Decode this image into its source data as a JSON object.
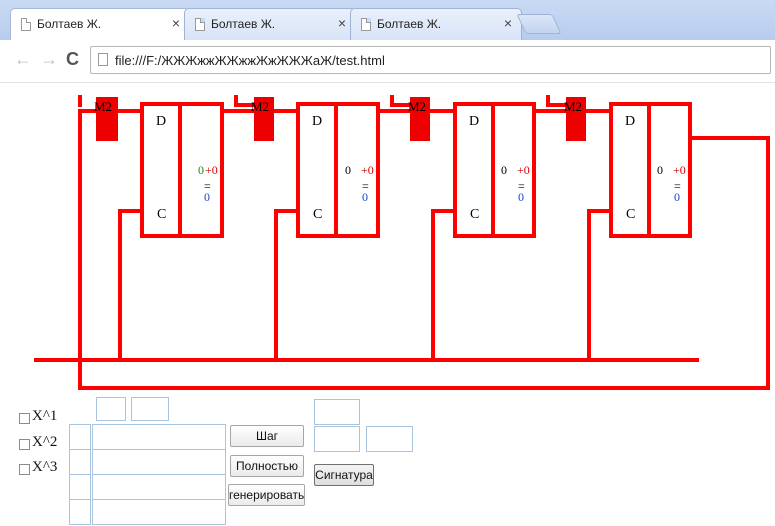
{
  "browser": {
    "tabs": [
      {
        "title": "Болтаев Ж.",
        "close": "×",
        "active": true
      },
      {
        "title": "Болтаев Ж.",
        "close": "×",
        "active": false
      },
      {
        "title": "Болтаев Ж.",
        "close": "×",
        "active": false
      }
    ],
    "nav": {
      "back": "←",
      "forward": "→",
      "reload": "C"
    },
    "url": "file:///F:/ЖЖЖжжЖЖжжЖжЖЖЖаЖ/test.html"
  },
  "circuit": {
    "colors": {
      "wire": "#ff0000",
      "mod": "#ee0000",
      "green": "#1a8a1a",
      "blue": "#1a3fd1"
    },
    "modules": [
      "M2",
      "M2",
      "M2",
      "M2"
    ],
    "triggers": [
      {
        "d": "D",
        "c": "C",
        "q": "0",
        "plus": "+0",
        "bar": "=",
        "blue": "0"
      },
      {
        "d": "D",
        "c": "C",
        "q": "0",
        "plus": "+0",
        "bar": "=",
        "blue": "0"
      },
      {
        "d": "D",
        "c": "C",
        "q": "0",
        "plus": "+0",
        "bar": "=",
        "blue": "0"
      },
      {
        "d": "D",
        "c": "C",
        "q": "0",
        "plus": "+0",
        "bar": "=",
        "blue": "0"
      }
    ]
  },
  "controls": {
    "checkboxes": [
      {
        "label": "X^1",
        "checked": false
      },
      {
        "label": "X^2",
        "checked": false
      },
      {
        "label": "X^3",
        "checked": false
      }
    ],
    "buttons": {
      "step": "Шаг",
      "full": "Полностью",
      "generate": "генерировать",
      "signature": "Сигнатура"
    }
  }
}
